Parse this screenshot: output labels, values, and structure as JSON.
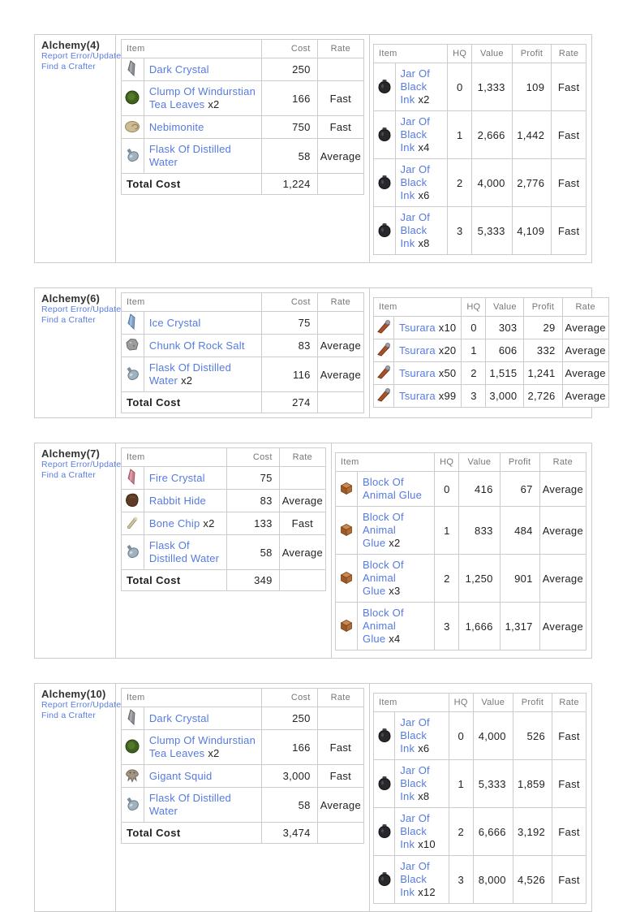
{
  "colors": {
    "link_blue": "#567be0",
    "fast_green": "#41b541",
    "average_yellow": "#bcbc2a",
    "profit_green": "#3cb83c",
    "border_gray": "#cccccc",
    "header_text_gray": "#777777",
    "body_text": "#222222"
  },
  "sections": [
    {
      "title": "Alchemy(4)",
      "links": [
        "Report Error/Update",
        "Find a Crafter"
      ],
      "ingredients": {
        "headers": {
          "item": "Item",
          "cost": "Cost",
          "rate": "Rate"
        },
        "rows": [
          {
            "icon": "dark-crystal-icon",
            "name": "Dark Crystal",
            "qty": "",
            "cost": "250",
            "rate": ""
          },
          {
            "icon": "tea-leaves-icon",
            "name": "Clump Of Windurstian Tea Leaves",
            "qty": "x2",
            "cost": "166",
            "rate": "Fast"
          },
          {
            "icon": "nebimonite-icon",
            "name": "Nebimonite",
            "qty": "",
            "cost": "750",
            "rate": "Fast"
          },
          {
            "icon": "flask-icon",
            "name": "Flask Of Distilled Water",
            "qty": "",
            "cost": "58",
            "rate": "Average"
          }
        ],
        "total_label": "Total Cost",
        "total": "1,224"
      },
      "results": {
        "headers": {
          "item": "Item",
          "hq": "HQ",
          "value": "Value",
          "profit": "Profit",
          "rate": "Rate"
        },
        "rows": [
          {
            "icon": "black-ink-icon",
            "name": "Jar Of Black Ink",
            "qty": "x2",
            "hq": "0",
            "value": "1,333",
            "profit": "109",
            "rate": "Fast"
          },
          {
            "icon": "black-ink-icon",
            "name": "Jar Of Black Ink",
            "qty": "x4",
            "hq": "1",
            "value": "2,666",
            "profit": "1,442",
            "rate": "Fast"
          },
          {
            "icon": "black-ink-icon",
            "name": "Jar Of Black Ink",
            "qty": "x6",
            "hq": "2",
            "value": "4,000",
            "profit": "2,776",
            "rate": "Fast"
          },
          {
            "icon": "black-ink-icon",
            "name": "Jar Of Black Ink",
            "qty": "x8",
            "hq": "3",
            "value": "5,333",
            "profit": "4,109",
            "rate": "Fast"
          }
        ]
      }
    },
    {
      "title": "Alchemy(6)",
      "links": [
        "Report Error/Update",
        "Find a Crafter"
      ],
      "ingredients": {
        "headers": {
          "item": "Item",
          "cost": "Cost",
          "rate": "Rate"
        },
        "rows": [
          {
            "icon": "ice-crystal-icon",
            "name": "Ice Crystal",
            "qty": "",
            "cost": "75",
            "rate": ""
          },
          {
            "icon": "rock-salt-icon",
            "name": "Chunk Of Rock Salt",
            "qty": "",
            "cost": "83",
            "rate": "Average"
          },
          {
            "icon": "flask-icon",
            "name": "Flask Of Distilled Water",
            "qty": "x2",
            "cost": "116",
            "rate": "Average"
          }
        ],
        "total_label": "Total Cost",
        "total": "274"
      },
      "results": {
        "headers": {
          "item": "Item",
          "hq": "HQ",
          "value": "Value",
          "profit": "Profit",
          "rate": "Rate"
        },
        "rows": [
          {
            "icon": "tsurara-icon",
            "name": "Tsurara",
            "qty": "x10",
            "hq": "0",
            "value": "303",
            "profit": "29",
            "rate": "Average"
          },
          {
            "icon": "tsurara-icon",
            "name": "Tsurara",
            "qty": "x20",
            "hq": "1",
            "value": "606",
            "profit": "332",
            "rate": "Average"
          },
          {
            "icon": "tsurara-icon",
            "name": "Tsurara",
            "qty": "x50",
            "hq": "2",
            "value": "1,515",
            "profit": "1,241",
            "rate": "Average"
          },
          {
            "icon": "tsurara-icon",
            "name": "Tsurara",
            "qty": "x99",
            "hq": "3",
            "value": "3,000",
            "profit": "2,726",
            "rate": "Average"
          }
        ]
      }
    },
    {
      "title": "Alchemy(7)",
      "links": [
        "Report Error/Update",
        "Find a Crafter"
      ],
      "ingredients": {
        "headers": {
          "item": "Item",
          "cost": "Cost",
          "rate": "Rate"
        },
        "rows": [
          {
            "icon": "fire-crystal-icon",
            "name": "Fire Crystal",
            "qty": "",
            "cost": "75",
            "rate": ""
          },
          {
            "icon": "rabbit-hide-icon",
            "name": "Rabbit Hide",
            "qty": "",
            "cost": "83",
            "rate": "Average"
          },
          {
            "icon": "bone-chip-icon",
            "name": "Bone Chip",
            "qty": "x2",
            "cost": "133",
            "rate": "Fast"
          },
          {
            "icon": "flask-icon",
            "name": "Flask Of Distilled Water",
            "qty": "",
            "cost": "58",
            "rate": "Average"
          }
        ],
        "total_label": "Total Cost",
        "total": "349"
      },
      "results": {
        "headers": {
          "item": "Item",
          "hq": "HQ",
          "value": "Value",
          "profit": "Profit",
          "rate": "Rate"
        },
        "rows": [
          {
            "icon": "animal-glue-icon",
            "name": "Block Of Animal Glue",
            "qty": "",
            "hq": "0",
            "value": "416",
            "profit": "67",
            "rate": "Average"
          },
          {
            "icon": "animal-glue-icon",
            "name": "Block Of Animal Glue",
            "qty": "x2",
            "hq": "1",
            "value": "833",
            "profit": "484",
            "rate": "Average"
          },
          {
            "icon": "animal-glue-icon",
            "name": "Block Of Animal Glue",
            "qty": "x3",
            "hq": "2",
            "value": "1,250",
            "profit": "901",
            "rate": "Average"
          },
          {
            "icon": "animal-glue-icon",
            "name": "Block Of Animal Glue",
            "qty": "x4",
            "hq": "3",
            "value": "1,666",
            "profit": "1,317",
            "rate": "Average"
          }
        ]
      }
    },
    {
      "title": "Alchemy(10)",
      "links": [
        "Report Error/Update",
        "Find a Crafter"
      ],
      "ingredients": {
        "headers": {
          "item": "Item",
          "cost": "Cost",
          "rate": "Rate"
        },
        "rows": [
          {
            "icon": "dark-crystal-icon",
            "name": "Dark Crystal",
            "qty": "",
            "cost": "250",
            "rate": ""
          },
          {
            "icon": "tea-leaves-icon",
            "name": "Clump Of Windurstian Tea Leaves",
            "qty": "x2",
            "cost": "166",
            "rate": "Fast"
          },
          {
            "icon": "gigant-squid-icon",
            "name": "Gigant Squid",
            "qty": "",
            "cost": "3,000",
            "rate": "Fast"
          },
          {
            "icon": "flask-icon",
            "name": "Flask Of Distilled Water",
            "qty": "",
            "cost": "58",
            "rate": "Average"
          }
        ],
        "total_label": "Total Cost",
        "total": "3,474"
      },
      "results": {
        "headers": {
          "item": "Item",
          "hq": "HQ",
          "value": "Value",
          "profit": "Profit",
          "rate": "Rate"
        },
        "rows": [
          {
            "icon": "black-ink-icon",
            "name": "Jar Of Black Ink",
            "qty": "x6",
            "hq": "0",
            "value": "4,000",
            "profit": "526",
            "rate": "Fast"
          },
          {
            "icon": "black-ink-icon",
            "name": "Jar Of Black Ink",
            "qty": "x8",
            "hq": "1",
            "value": "5,333",
            "profit": "1,859",
            "rate": "Fast"
          },
          {
            "icon": "black-ink-icon",
            "name": "Jar Of Black Ink",
            "qty": "x10",
            "hq": "2",
            "value": "6,666",
            "profit": "3,192",
            "rate": "Fast"
          },
          {
            "icon": "black-ink-icon",
            "name": "Jar Of Black Ink",
            "qty": "x12",
            "hq": "3",
            "value": "8,000",
            "profit": "4,526",
            "rate": "Fast"
          }
        ]
      }
    }
  ]
}
